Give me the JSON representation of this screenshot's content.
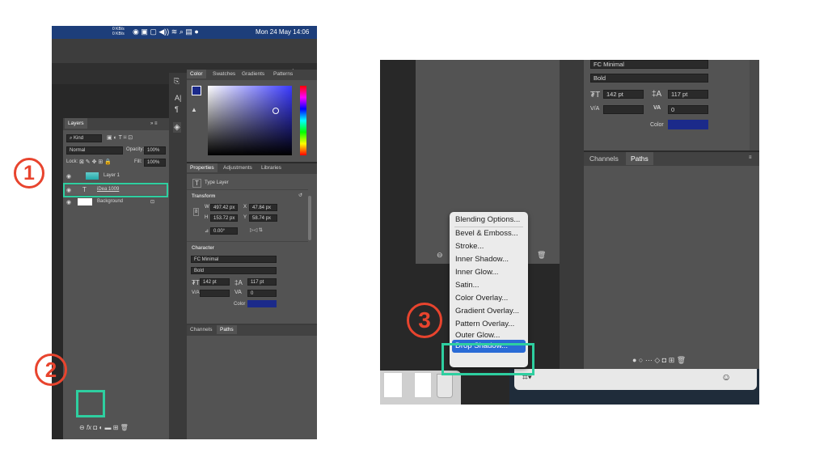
{
  "menubar": {
    "net_up": "0 KB/s",
    "net_down": "0 KB/s",
    "clock": "Mon 24 May  14:06"
  },
  "panels": {
    "color_tabs": [
      "Color",
      "Swatches",
      "Gradients",
      "Patterns"
    ],
    "layers": {
      "title": "Layers",
      "kind": "Kind",
      "blend_mode": "Normal",
      "opacity_label": "Opacity:",
      "opacity_value": "100%",
      "lock_label": "Lock:",
      "fill_label": "Fill:",
      "fill_value": "100%",
      "items": [
        "Layer 1",
        "iDea 1009",
        "Background"
      ]
    },
    "properties_tabs": [
      "Properties",
      "Adjustments",
      "Libraries"
    ],
    "type_layer": "Type Layer",
    "transform": {
      "title": "Transform",
      "w_label": "W",
      "w_value": "497.42 px",
      "x_label": "X",
      "x_value": "47.84 px",
      "h_label": "H",
      "h_value": "153.72 px",
      "y_label": "Y",
      "y_value": "58.74 px",
      "angle": "0.00°"
    },
    "character": {
      "title": "Character",
      "font": "FC Minimal",
      "style": "Bold",
      "size": "142 pt",
      "leading": "117 pt",
      "tracking": "0",
      "color_label": "Color",
      "color": "#1b2a8a"
    },
    "channels_tabs": [
      "Channels",
      "Paths"
    ]
  },
  "context_menu": {
    "items": [
      "Blending Options...",
      "Bevel & Emboss...",
      "Stroke...",
      "Inner Shadow...",
      "Inner Glow...",
      "Satin...",
      "Color Overlay...",
      "Gradient Overlay...",
      "Pattern Overlay...",
      "Outer Glow...",
      "Drop Shadow..."
    ],
    "selected": "Drop Shadow..."
  },
  "annotations": {
    "step1": "1",
    "step2": "2",
    "step3": "3",
    "highlight_color": "#2ecfa0",
    "number_color": "#e8442e"
  },
  "colors": {
    "panel_bg": "#535353",
    "dark_bg": "#3a3a3a",
    "menu_select": "#2a6bd6"
  }
}
